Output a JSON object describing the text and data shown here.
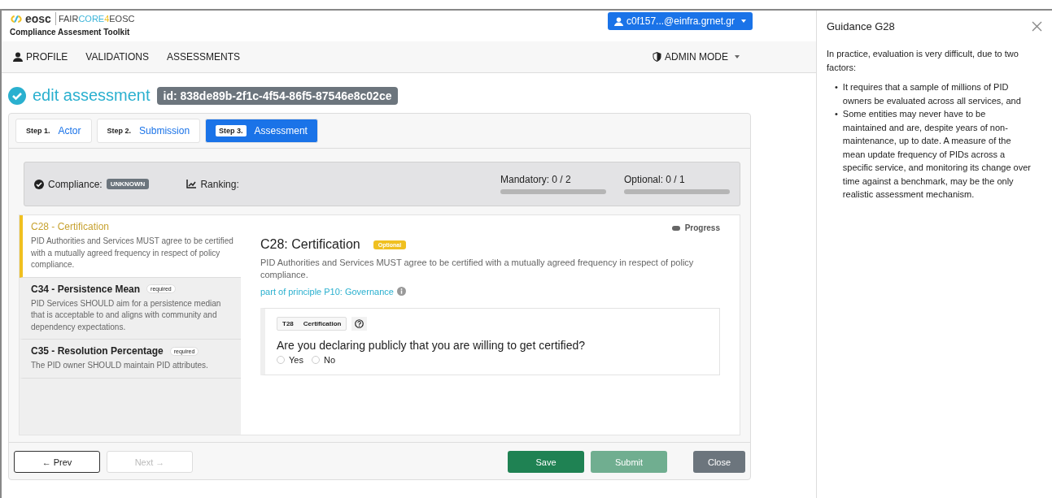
{
  "header": {
    "logo_text": "eosc",
    "partner_logo": [
      "FAIR",
      "CORE",
      "4",
      "EOSC"
    ],
    "app_title": "Compliance Assesment Toolkit",
    "user_button": "c0f157...@einfra.grnet.gr"
  },
  "nav": {
    "items": [
      {
        "label": "PROFILE",
        "kind": "user"
      },
      {
        "label": "VALIDATIONS",
        "kind": "plain"
      },
      {
        "label": "ASSESSMENTS",
        "kind": "plain"
      }
    ],
    "admin": "ADMIN MODE"
  },
  "page": {
    "title": "edit assessment",
    "id_badge": "id: 838de89b-2f1c-4f54-86f5-87546e8c02ce"
  },
  "steps": [
    {
      "step": "Step 1.",
      "label": "Actor",
      "selected": false
    },
    {
      "step": "Step 2.",
      "label": "Submission",
      "selected": false
    },
    {
      "step": "Step 3.",
      "label": "Assessment",
      "selected": true
    }
  ],
  "summary": {
    "compliance_label": "Compliance:",
    "compliance_value": "UNKNOWN",
    "ranking_label": "Ranking:",
    "meters": [
      {
        "label": "Mandatory: 0 / 2",
        "level": 0
      },
      {
        "label": "Optional: 0 / 1",
        "level": 0
      }
    ]
  },
  "criteria": [
    {
      "title": "C28 - Certification",
      "description": "PID Authorities and Services MUST agree to be certified with a mutually agreed frequency in respect of policy compliance.",
      "selected": true
    },
    {
      "title": "C34 - Persistence Mean",
      "badge": "required",
      "description": "PID Services SHOULD aim for a persistence median that is acceptable to and aligns with community and dependency expectations.",
      "selected": false
    },
    {
      "title": "C35 - Resolution Percentage",
      "badge": "required",
      "description": "The PID owner SHOULD maintain PID attributes.",
      "selected": false
    }
  ],
  "detail": {
    "progress_label": "Progress",
    "title": "C28: Certification",
    "badge": "Optional",
    "description": "PID Authorities and Services MUST agree to be certified with a mutually agreed frequency in respect of policy compliance.",
    "principle_link": "part of principle P10: Governance",
    "test": {
      "code": "T28",
      "name": "Certification",
      "question": "Are you declaring publicly that you are willing to get certified?",
      "options": [
        {
          "label": "Yes",
          "selected": false
        },
        {
          "label": "No",
          "selected": false
        }
      ]
    }
  },
  "footer": {
    "buttons": [
      {
        "label": "← Prev",
        "kind": "outline",
        "disabled": false
      },
      {
        "label": "Next →",
        "kind": "outline",
        "disabled": true
      },
      {
        "label": "Save",
        "kind": "success",
        "disabled": false
      },
      {
        "label": "Submit",
        "kind": "success",
        "disabled": true
      },
      {
        "label": "Close",
        "kind": "secondary",
        "disabled": false
      }
    ]
  },
  "guidance": {
    "title": "Guidance G28",
    "intro": "In practice, evaluation is very difficult, due to two factors:",
    "bullets": [
      {
        "marker": "•",
        "text": "It requires that a sample of millions of PID owners be evaluated across all services, and"
      },
      {
        "marker": "•",
        "text": "Some entities may never have to be maintained and are, despite years of non-maintenance, up to date. A measure of the mean update frequency of PIDs across a specific service, and monitoring its change over time against a benchmark, may be the only realistic assessment mechanism."
      }
    ]
  }
}
